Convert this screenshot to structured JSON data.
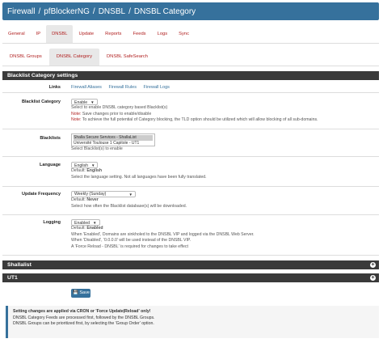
{
  "breadcrumb": [
    "Firewall",
    "pfBlockerNG",
    "DNSBL",
    "DNSBL Category"
  ],
  "tabs_primary": [
    "General",
    "IP",
    "DNSBL",
    "Update",
    "Reports",
    "Feeds",
    "Logs",
    "Sync"
  ],
  "tabs_secondary": [
    "DNSBL Groups",
    "DNSBL Category",
    "DNSBL SafeSearch"
  ],
  "section": {
    "title": "Blacklist Category settings"
  },
  "links": {
    "label": "Links",
    "items": [
      "Firewall Aliases",
      "Firewall Rules",
      "Firewall Logs"
    ]
  },
  "blacklist_category": {
    "label": "Blacklist Category",
    "value": "Enable",
    "help": "Select to enable DNSBL category based Blacklist(s)",
    "note1_prefix": "Note:",
    "note1": "Save changes prior to enable/disable",
    "note2_prefix": "Note:",
    "note2": "To achieve the full potential of Category blocking, the TLD option should be utilized which will allow blocking of all sub-domains."
  },
  "blacklists": {
    "label": "Blacklists",
    "options": [
      "Shalla Secure Services - ShallaList",
      "Université Toulouse 1 Capitole - UT1"
    ],
    "help": "Select Blacklist(s) to enable"
  },
  "language": {
    "label": "Language",
    "value": "English",
    "default_prefix": "Default:",
    "default": "English",
    "help": "Select the language setting. Not all languages have been fully translated."
  },
  "update_frequency": {
    "label": "Update Frequency",
    "value": "Weekly (Sunday)",
    "default_prefix": "Default:",
    "default": "Never",
    "help": "Select how often the Blacklist database(s) will be downloaded."
  },
  "logging": {
    "label": "Logging",
    "value": "Enabled",
    "default_prefix": "Default:",
    "default": "Enabled",
    "help1": "When 'Enabled', Domains are sinkholed to the DNSBL VIP and logged via the DNSBL Web Server.",
    "help2": "When 'Disabled', '0.0.0.0' will be used instead of the DNSBL VIP.",
    "help3": "A 'Force Reload - DNSBL' is required for changes to take effect"
  },
  "collapsed_sections": [
    "Shallalist",
    "UT1"
  ],
  "save_label": "Save",
  "info": {
    "line1": "Setting changes are applied via CRON or 'Force Update|Reload' only!",
    "line2": "DNSBL Category Feeds are processed first, followed by the DNSBL Groups.",
    "line3": "DNSBL Groups can be prioritized first, by selecting the 'Group Order' option."
  }
}
